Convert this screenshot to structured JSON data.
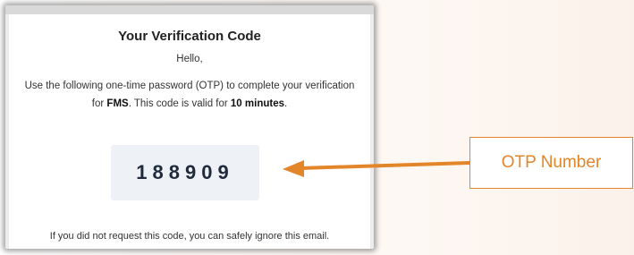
{
  "email": {
    "title": "Your Verification Code",
    "greeting": "Hello,",
    "message_part1": "Use the following one-time password (OTP) to complete your verification for ",
    "app_name": "FMS",
    "message_part2": ". This code is valid for ",
    "validity": "10 minutes",
    "message_part3": ".",
    "otp_code": "188909",
    "footer": "If you did not request this code, you can safely ignore this email."
  },
  "annotation": {
    "label": "OTP Number",
    "color": "#e3862a"
  }
}
